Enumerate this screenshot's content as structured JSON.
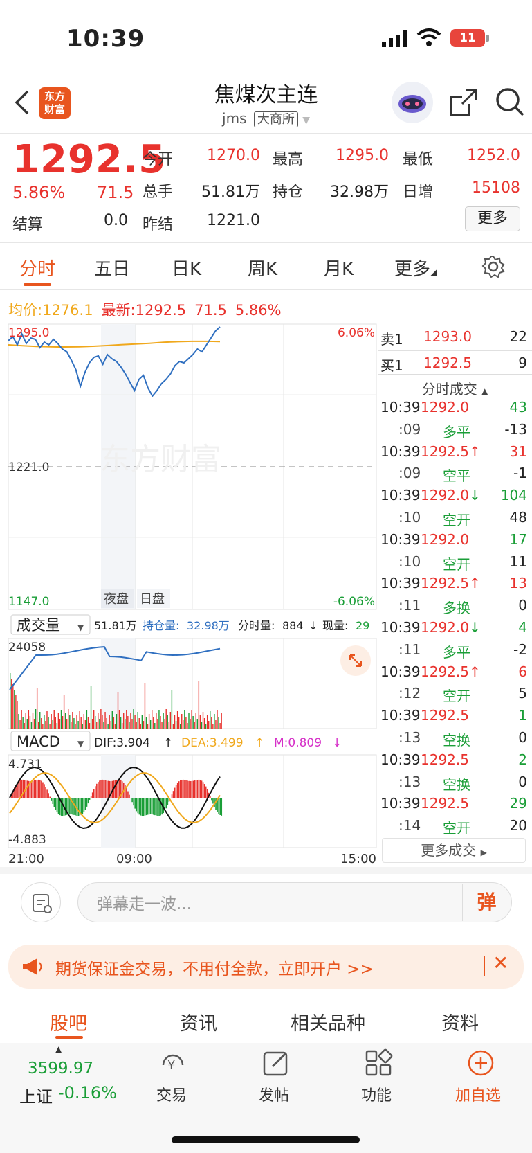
{
  "status_bar": {
    "time": "10:39",
    "battery": "11"
  },
  "header": {
    "title": "焦煤次主连",
    "code": "jms",
    "exchange": "大商所",
    "logo_text_line1": "东方",
    "logo_text_line2": "财富"
  },
  "quote": {
    "price": "1292.5",
    "pct": "5.86%",
    "change": "71.5",
    "settle_label": "结算",
    "settle_value": "0.0",
    "fields": [
      {
        "label": "今开",
        "value": "1270.0"
      },
      {
        "label": "最高",
        "value": "1295.0"
      },
      {
        "label": "最低",
        "value": "1252.0"
      },
      {
        "label": "总手",
        "value": "51.81万"
      },
      {
        "label": "持仓",
        "value": "32.98万"
      },
      {
        "label": "日增",
        "value": "15108"
      },
      {
        "label": "昨结",
        "value": "1221.0"
      }
    ],
    "more_button": "更多"
  },
  "tabs": [
    "分时",
    "五日",
    "日K",
    "周K",
    "月K",
    "更多"
  ],
  "info_line": {
    "avg_label": "均价:",
    "avg_value": "1276.1",
    "latest_label": "最新:",
    "latest_value": "1292.5",
    "latest_change": "71.5",
    "latest_pct": "5.86%"
  },
  "chart_labels": {
    "top_price": "1295.0",
    "top_pct": "6.06%",
    "mid_price": "1221.0",
    "bottom_price": "1147.0",
    "bottom_pct": "-6.06%",
    "night": "夜盘",
    "day": "日盘",
    "watermark": "东方财富",
    "volume_selector": "成交量",
    "volume_total": "51.81万",
    "oi_label": "持仓量:",
    "oi_value": "32.98万",
    "tick_vol_label": "分时量:",
    "tick_vol_value": "884",
    "now_vol_label": "现量:",
    "now_vol_value": "29",
    "vol_axis_top": "24058",
    "macd_selector": "MACD",
    "dif": "DIF:3.904",
    "dea": "DEA:3.499",
    "m": "M:0.809",
    "macd_top": "4.731",
    "macd_bottom": "-4.883",
    "x_start": "21:00",
    "x_mid": "09:00",
    "x_end": "15:00"
  },
  "order_book": {
    "sell": {
      "label": "卖1",
      "price": "1293.0",
      "qty": "22"
    },
    "buy": {
      "label": "买1",
      "price": "1292.5",
      "qty": "9"
    },
    "trades_header": "分时成交"
  },
  "trades": [
    {
      "time": "10:39",
      "price": "1292.0",
      "dir": "",
      "vol": "43",
      "type": "多平",
      "sec": ":09",
      "oi": "-13"
    },
    {
      "time": "10:39",
      "price": "1292.5",
      "dir": "↑",
      "vol": "31",
      "type": "空平",
      "sec": ":09",
      "oi": "-1"
    },
    {
      "time": "10:39",
      "price": "1292.0",
      "dir": "↓",
      "vol": "104",
      "type": "空开",
      "sec": ":10",
      "oi": "48"
    },
    {
      "time": "10:39",
      "price": "1292.0",
      "dir": "",
      "vol": "17",
      "type": "空开",
      "sec": ":10",
      "oi": "11"
    },
    {
      "time": "10:39",
      "price": "1292.5",
      "dir": "↑",
      "vol": "13",
      "type": "多换",
      "sec": ":11",
      "oi": "0"
    },
    {
      "time": "10:39",
      "price": "1292.0",
      "dir": "↓",
      "vol": "4",
      "type": "多平",
      "sec": ":11",
      "oi": "-2"
    },
    {
      "time": "10:39",
      "price": "1292.5",
      "dir": "↑",
      "vol": "6",
      "type": "空开",
      "sec": ":12",
      "oi": "5"
    },
    {
      "time": "10:39",
      "price": "1292.5",
      "dir": "",
      "vol": "1",
      "type": "空换",
      "sec": ":13",
      "oi": "0"
    },
    {
      "time": "10:39",
      "price": "1292.5",
      "dir": "",
      "vol": "2",
      "type": "空换",
      "sec": ":13",
      "oi": "0"
    },
    {
      "time": "10:39",
      "price": "1292.5",
      "dir": "",
      "vol": "29",
      "type": "空开",
      "sec": ":14",
      "oi": "20"
    }
  ],
  "more_trades": "更多成交",
  "comment": {
    "placeholder": "弹幕走一波...",
    "danmu_button": "弹"
  },
  "ad": {
    "text": "期货保证金交易，不用付全款，立即开户 >>"
  },
  "sub_tabs": [
    "股吧",
    "资讯",
    "相关品种",
    "资料"
  ],
  "toolbar": {
    "index_value": "3599.97",
    "index_name": "上证",
    "index_pct": "-0.16%",
    "items": [
      "交易",
      "发帖",
      "功能",
      "加自选"
    ]
  },
  "colors": {
    "accent": "#e8551e",
    "up": "#e8322d",
    "down": "#1a9e37",
    "price_line": "#2f6fc0",
    "avg_line": "#f0a81c"
  }
}
